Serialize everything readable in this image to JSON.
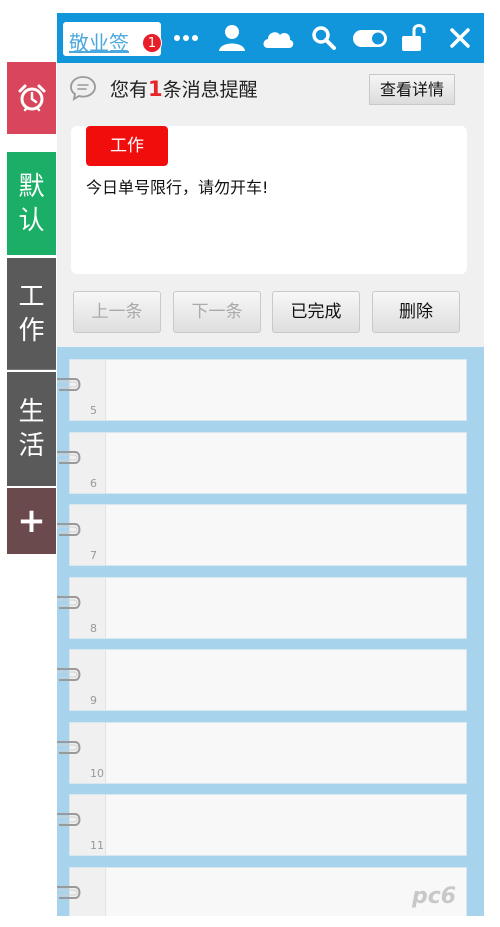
{
  "sidebar": {
    "alarm_icon": "alarm-clock-icon",
    "tabs": [
      {
        "label": "默认",
        "color": "#1aae66"
      },
      {
        "label": "工作",
        "color": "#5a5a5a"
      },
      {
        "label": "生活",
        "color": "#5a5a5a"
      }
    ],
    "add_label": "+"
  },
  "titlebar": {
    "brand": "敬业签",
    "badge": "1",
    "icons": [
      "more-icon",
      "user-icon",
      "cloud-icon",
      "search-icon",
      "toggle-icon",
      "unlock-icon",
      "close-icon"
    ],
    "color": "#1296db"
  },
  "reminder": {
    "prefix": "您有",
    "count": "1",
    "suffix": "条消息提醒",
    "detail_button": "查看详情",
    "card": {
      "tag": "工作",
      "tag_color": "#f20d0d",
      "text": "今日单号限行，请勿开车!"
    },
    "buttons": {
      "prev": "上一条",
      "next": "下一条",
      "done": "已完成",
      "delete": "删除"
    }
  },
  "notes": {
    "row_numbers": [
      "5",
      "6",
      "7",
      "8",
      "9",
      "10",
      "11",
      ""
    ]
  },
  "watermark": "pc6"
}
